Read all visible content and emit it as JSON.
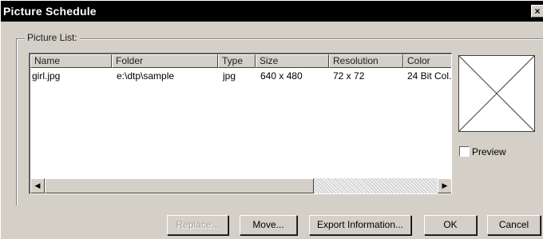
{
  "window": {
    "title": "Picture Schedule",
    "close_glyph": "×"
  },
  "group": {
    "label": "Picture List:"
  },
  "list": {
    "columns": [
      "Name",
      "Folder",
      "Type",
      "Size",
      "Resolution",
      "Color"
    ],
    "rows": [
      [
        "girl.jpg",
        "e:\\dtp\\sample",
        "jpg",
        "640 x 480",
        "72 x 72",
        "24 Bit Col.."
      ]
    ],
    "scroll_left_glyph": "◀",
    "scroll_right_glyph": "▶"
  },
  "preview": {
    "checkbox_label": "Preview",
    "checked": false
  },
  "buttons": {
    "replace": "Replace...",
    "move": "Move...",
    "export": "Export Information...",
    "ok": "OK",
    "cancel": "Cancel"
  },
  "colors": {
    "title_bar": "#000000",
    "dialog_face": "#d4d0c8"
  }
}
